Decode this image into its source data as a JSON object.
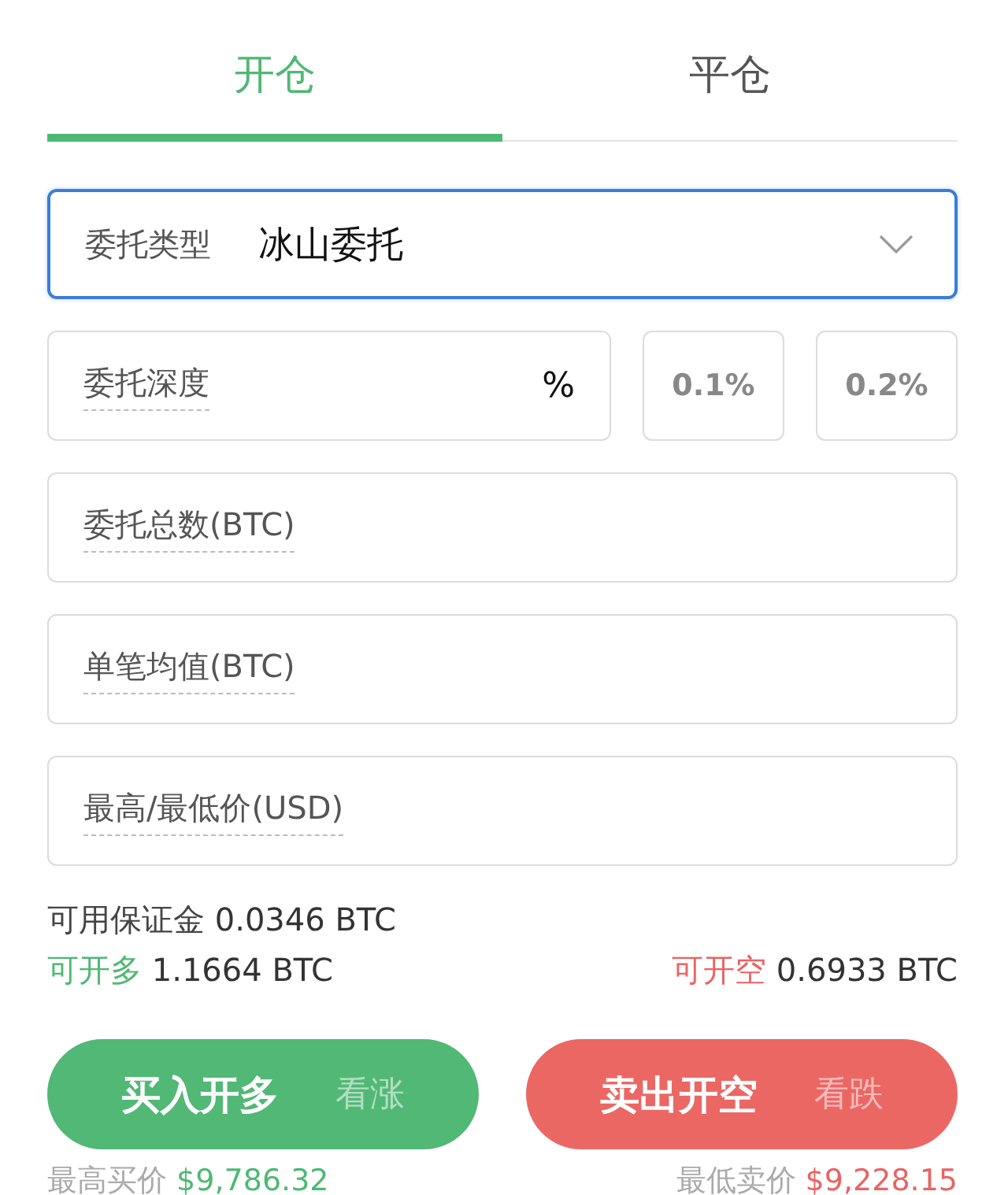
{
  "tabs": [
    {
      "label": "开仓",
      "selected": true
    },
    {
      "label": "平仓",
      "selected": false
    }
  ],
  "order_type": {
    "label": "委托类型",
    "value": "冰山委托"
  },
  "depth": {
    "label": "委托深度",
    "unit": "%",
    "presets": [
      "0.1%",
      "0.2%"
    ]
  },
  "fields": [
    {
      "label": "委托总数(BTC)"
    },
    {
      "label": "单笔均值(BTC)"
    },
    {
      "label": "最高/最低价(USD)"
    }
  ],
  "margin": {
    "label": "可用保证金",
    "value": "0.0346 BTC"
  },
  "long_available": {
    "label": "可开多",
    "value": "1.1664 BTC"
  },
  "short_available": {
    "label": "可开空",
    "value": "0.6933 BTC"
  },
  "buttons": [
    {
      "kind": "buy",
      "label": "买入开多",
      "hint": "看涨"
    },
    {
      "kind": "sell",
      "label": "卖出开空",
      "hint": "看跌"
    }
  ],
  "best_bid": {
    "label": "最高买价",
    "value": "$9,786.32"
  },
  "best_ask": {
    "label": "最低卖价",
    "value": "$9,228.15"
  }
}
